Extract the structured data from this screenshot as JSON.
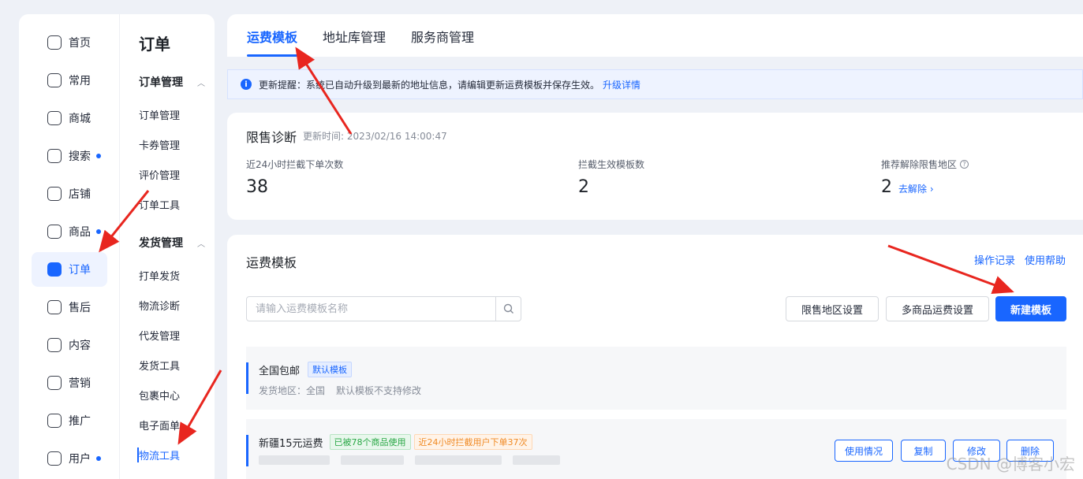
{
  "sidebar": {
    "items": [
      {
        "label": "首页",
        "icon": "home-icon",
        "dot": false
      },
      {
        "label": "常用",
        "icon": "folder-icon",
        "dot": false
      },
      {
        "label": "商城",
        "icon": "shop-icon",
        "dot": false
      },
      {
        "label": "搜索",
        "icon": "search-chart-icon",
        "dot": true
      },
      {
        "label": "店铺",
        "icon": "store-icon",
        "dot": false
      },
      {
        "label": "商品",
        "icon": "bag-icon",
        "dot": true
      },
      {
        "label": "订单",
        "icon": "order-icon",
        "dot": false,
        "active": true
      },
      {
        "label": "售后",
        "icon": "after-sale-icon",
        "dot": false
      },
      {
        "label": "内容",
        "icon": "tv-icon",
        "dot": false
      },
      {
        "label": "营销",
        "icon": "megaphone-icon",
        "dot": false
      },
      {
        "label": "推广",
        "icon": "promote-icon",
        "dot": false
      },
      {
        "label": "用户",
        "icon": "user-icon",
        "dot": true
      }
    ]
  },
  "submenu": {
    "title": "订单",
    "group1": {
      "label": "订单管理",
      "items": [
        "订单管理",
        "卡券管理",
        "评价管理",
        "订单工具"
      ]
    },
    "group2": {
      "label": "发货管理",
      "items": [
        "打单发货",
        "物流诊断",
        "代发管理",
        "发货工具",
        "包裹中心",
        "电子面单",
        "物流工具"
      ]
    }
  },
  "tabs": [
    "运费模板",
    "地址库管理",
    "服务商管理"
  ],
  "notice": {
    "text": "更新提醒：系统已自动升级到最新的地址信息，请编辑更新运费模板并保存生效。",
    "link": "升级详情"
  },
  "diagnosis": {
    "title": "限售诊断",
    "updated": "更新时间: 2023/02/16 14:00:47",
    "stats": [
      {
        "label": "近24小时拦截下单次数",
        "value": "38"
      },
      {
        "label": "拦截生效模板数",
        "value": "2"
      },
      {
        "label": "推荐解除限售地区",
        "value": "2",
        "link": "去解除 ›"
      }
    ]
  },
  "templates": {
    "title": "运费模板",
    "links": [
      "操作记录",
      "使用帮助"
    ],
    "search_placeholder": "请输入运费模板名称",
    "buttons": {
      "restrict": "限售地区设置",
      "multi": "多商品运费设置",
      "create": "新建模板"
    },
    "rows": [
      {
        "name": "全国包邮",
        "tag": "默认模板",
        "meta": [
          "发货地区：全国",
          "默认模板不支持修改"
        ]
      },
      {
        "name": "新疆15元运费",
        "tag_used": "已被78个商品使用",
        "tag_block": "近24小时拦截用户下单37次",
        "actions": [
          "使用情况",
          "复制",
          "修改",
          "删除"
        ]
      }
    ]
  },
  "watermark": "CSDN @博客小宏",
  "colors": {
    "accent": "#1966ff",
    "annotation": "#e8261f"
  }
}
